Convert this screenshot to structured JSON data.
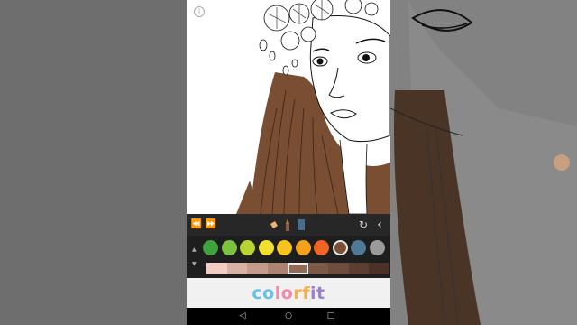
{
  "info_label": "i",
  "toolbar": {
    "rewind": "⏪",
    "fast_forward": "⏩",
    "refresh": "↻",
    "back": "‹"
  },
  "palette": {
    "up_arrow": "▲",
    "down_arrow": "▼",
    "colors": [
      "#3ea33e",
      "#7cc142",
      "#b8d433",
      "#f1df2f",
      "#f7c31d",
      "#f5a21b",
      "#f06424",
      "#7c5034",
      "#4f7a97",
      "#9a9a9a"
    ],
    "selected_color": "#7c5034",
    "shades": [
      "#f1cdc4",
      "#d9b2a6",
      "#c49c8b",
      "#ad8472",
      "#8f6b58",
      "#7b5946",
      "#6e4d3c",
      "#5c3f30",
      "#4a3226"
    ],
    "selected_shade": "#8f6b58"
  },
  "brand": {
    "letters": [
      "c",
      "o",
      "l",
      "o",
      "r",
      "f",
      "i",
      "t"
    ],
    "letter_colors": [
      "#67c2e6",
      "#67c2e6",
      "#f28aa9",
      "#f28aa9",
      "#f5b04d",
      "#f5b04d",
      "#9b7fd0",
      "#9b7fd0"
    ]
  },
  "navbar": {
    "back": "◁",
    "home": "○",
    "recents": "□"
  }
}
